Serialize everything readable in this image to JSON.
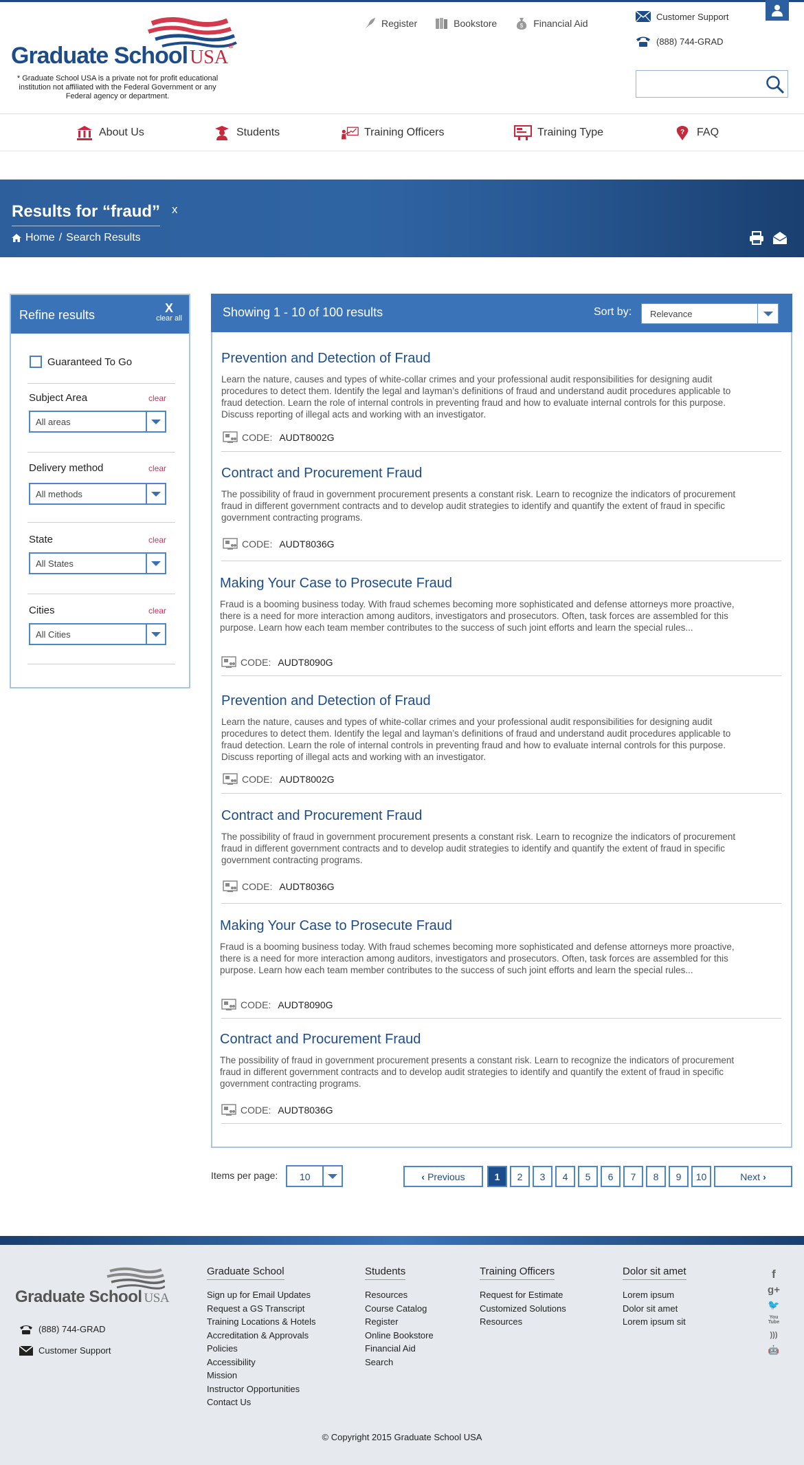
{
  "header": {
    "logo_word": "Graduate School",
    "logo_usa": "USA",
    "logo_tm": "®",
    "disclaimer": "* Graduate School USA is a private not for profit educational institution not affiliated with the Federal Government or any Federal agency or department.",
    "top_links": [
      {
        "label": "Register",
        "icon": "quill-icon"
      },
      {
        "label": "Bookstore",
        "icon": "books-icon"
      },
      {
        "label": "Financial Aid",
        "icon": "money-bag-icon"
      }
    ],
    "support_label": "Customer Support",
    "phone": "(888) 744-GRAD",
    "search_placeholder": ""
  },
  "nav": [
    {
      "label": "About Us",
      "icon": "columns-building-icon"
    },
    {
      "label": "Students",
      "icon": "graduate-icon"
    },
    {
      "label": "Training Officers",
      "icon": "presenter-chart-icon"
    },
    {
      "label": "Training Type",
      "icon": "classroom-board-icon"
    },
    {
      "label": "FAQ",
      "icon": "question-pin-icon"
    }
  ],
  "banner": {
    "title": "Results for “fraud”",
    "close": "x",
    "crumb_home": "Home",
    "crumb_sep": "/",
    "crumb_current": "Search Results"
  },
  "sidebar": {
    "title": "Refine results",
    "clear_x": "X",
    "clear_all": "clear all",
    "guaranteed_label": "Guaranteed To Go",
    "clear_label": "clear",
    "filters": [
      {
        "label": "Subject Area",
        "value": "All areas"
      },
      {
        "label": "Delivery method",
        "value": "All methods"
      },
      {
        "label": "State",
        "value": "All States"
      },
      {
        "label": "Cities",
        "value": "All Cities"
      }
    ]
  },
  "results": {
    "showing": "Showing 1 - 10 of 100 results",
    "sort_label": "Sort by:",
    "sort_value": "Relevance",
    "code_label": "CODE:",
    "items": [
      {
        "title": "Prevention and Detection of Fraud",
        "desc": "Learn the nature, causes and types of white-collar crimes and your professional audit responsibilities for designing audit procedures to detect them. Identify the legal and layman’s definitions of fraud and understand audit procedures applicable to fraud detection. Learn the role of internal controls in preventing fraud and how to evaluate internal controls for this purpose. Discuss reporting of illegal acts and working with an investigator.",
        "code": "AUDT8002G"
      },
      {
        "title": "Contract and Procurement Fraud",
        "desc": "The possibility of fraud in government procurement presents a constant risk. Learn to recognize the indicators of procurement fraud in different government contracts and to develop audit strategies to identify and quantify the extent of fraud in specific government contracting programs.",
        "code": "AUDT8036G"
      },
      {
        "title": "Making Your Case to Prosecute Fraud",
        "desc": "Fraud is a booming business today. With fraud schemes becoming more sophisticated and defense attorneys more proactive, there is a need for more interaction among auditors, investigators and prosecutors. Often, task forces are assembled for this purpose. Learn how each team member contributes to the success of such joint efforts and learn the special rules...",
        "code": "AUDT8090G"
      },
      {
        "title": "Prevention and Detection of Fraud",
        "desc": "Learn the nature, causes and types of white-collar crimes and your professional audit responsibilities for designing audit procedures to detect them. Identify the legal and layman’s definitions of fraud and understand audit procedures applicable to fraud detection. Learn the role of internal controls in preventing fraud and how to evaluate internal controls for this purpose. Discuss reporting of illegal acts and working with an investigator.",
        "code": "AUDT8002G"
      },
      {
        "title": "Contract and Procurement Fraud",
        "desc": "The possibility of fraud in government procurement presents a constant risk. Learn to recognize the indicators of procurement fraud in different government contracts and to develop audit strategies to identify and quantify the extent of fraud in specific government contracting programs.",
        "code": "AUDT8036G"
      },
      {
        "title": "Making Your Case to Prosecute Fraud",
        "desc": "Fraud is a booming business today. With fraud schemes becoming more sophisticated and defense attorneys more proactive, there is a need for more interaction among auditors, investigators and prosecutors. Often, task forces are assembled for this purpose. Learn how each team member contributes to the success of such joint efforts and learn the special rules...",
        "code": "AUDT8090G"
      },
      {
        "title": "Contract and Procurement Fraud",
        "desc": "The possibility of fraud in government procurement presents a constant risk. Learn to recognize the indicators of procurement fraud in different government contracts and to develop audit strategies to identify and quantify the extent of fraud in specific government contracting programs.",
        "code": "AUDT8036G"
      }
    ]
  },
  "pagination": {
    "items_per_page_label": "Items per page:",
    "items_per_page": "10",
    "previous": "Previous",
    "next": "Next",
    "pages": [
      "1",
      "2",
      "3",
      "4",
      "5",
      "6",
      "7",
      "8",
      "9",
      "10"
    ],
    "current_page": "1"
  },
  "footer": {
    "logo_word": "Graduate School",
    "logo_usa": "USA",
    "phone": "(888) 744-GRAD",
    "support": "Customer Support",
    "columns": [
      {
        "heading": "Graduate School",
        "links": [
          "Sign up for Email Updates",
          "Request a GS Transcript",
          "Training Locations & Hotels",
          "Accreditation & Approvals",
          "Policies",
          "Accessibility",
          "Mission",
          "Instructor Opportunities",
          "Contact Us"
        ]
      },
      {
        "heading": "Students",
        "links": [
          "Resources",
          "Course Catalog",
          "Register",
          "Online Bookstore",
          "Financial Aid",
          "Search"
        ]
      },
      {
        "heading": "Training Officers",
        "links": [
          "Request for Estimate",
          "Customized Solutions",
          "Resources"
        ]
      },
      {
        "heading": "Dolor sit amet",
        "links": [
          "Lorem ipsum",
          "Dolor sit amet",
          "Lorem ipsum sit"
        ]
      }
    ],
    "social": [
      {
        "icon": "facebook-icon",
        "glyph": "f"
      },
      {
        "icon": "google-plus-icon",
        "glyph": "g+"
      },
      {
        "icon": "twitter-icon",
        "glyph": "🐦"
      },
      {
        "icon": "youtube-icon",
        "glyph": "You Tube"
      },
      {
        "icon": "rss-icon",
        "glyph": ")))"
      },
      {
        "icon": "android-icon",
        "glyph": "🤖"
      }
    ],
    "copyright": "© Copyright 2015 Graduate School USA"
  },
  "colors": {
    "brand_blue": "#1d4c8b",
    "accent_blue": "#3a73b7",
    "brand_red": "#c8283c",
    "clear_pink": "#d8305a"
  }
}
